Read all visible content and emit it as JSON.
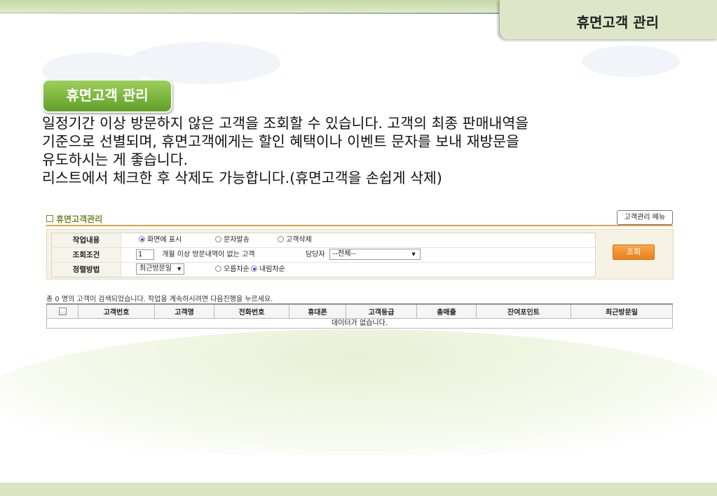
{
  "header": {
    "title": "휴면고객 관리"
  },
  "badge": {
    "label": "휴면고객 관리"
  },
  "description": {
    "lines": [
      "일정기간 이상 방문하지 않은 고객을 조회할 수 있습니다. 고객의 최종 판매내역을",
      "기준으로 선별되며, 휴면고객에게는 할인 혜택이나 이벤트 문자를 보내 재방문을",
      "유도하시는 게 좋습니다.",
      "리스트에서 체크한 후 삭제도 가능합니다.(휴면고객을 손쉽게 삭제)"
    ]
  },
  "panel": {
    "title": "휴면고객관리",
    "menu_button": "고객관리 메뉴",
    "search_button": "조회",
    "rows": {
      "task": {
        "label": "작업내용",
        "options": [
          "화면에 표시",
          "문자발송",
          "고객삭제"
        ],
        "selected": "화면에 표시"
      },
      "condition": {
        "label": "조회조건",
        "months_value": "1",
        "months_text": "개월 이상 방문내역이 없는 고객",
        "manager_label": "담당자",
        "manager_value": "--전체--"
      },
      "sort": {
        "label": "정렬방법",
        "sort_value": "최근방문일",
        "options": [
          "오름차순",
          "내림차순"
        ],
        "selected": "내림차순"
      }
    },
    "count_line": "총 0 명의 고객이 검색되었습니다. 작업을 계속하시려면 다음진행을 누르세요.",
    "table": {
      "columns": [
        "고객번호",
        "고객명",
        "전화번호",
        "휴대폰",
        "고객등급",
        "총매출",
        "잔여포인트",
        "최근방문일"
      ],
      "empty_message": "데이터가 없습니다."
    }
  },
  "colors": {
    "accent_green": "#5f9f26",
    "header_band": "#c5d7a4",
    "panel_orange": "#e9a03a",
    "title_green": "#6c8a2a"
  }
}
